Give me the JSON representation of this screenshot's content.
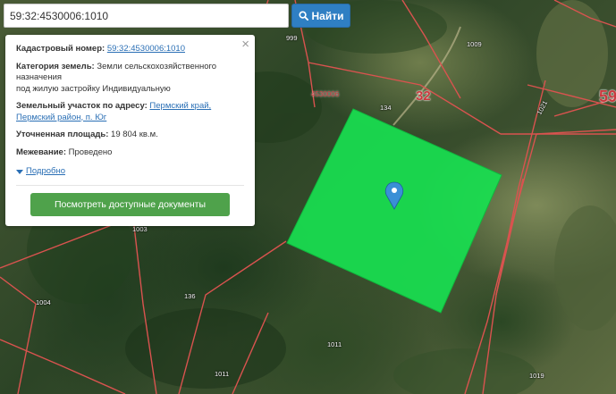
{
  "search": {
    "value": "59:32:4530006:1010",
    "button_label": "Найти",
    "button_icon": "search-icon"
  },
  "popup": {
    "cadastral_label": "Кадастровый номер:",
    "cadastral_value": "59:32:4530006:1010",
    "category_label": "Категория земель:",
    "category_value_1": "Земли сельскохозяйственного",
    "category_value_2": "назначения",
    "category_value_3": "под жилую застройку Индивидуальную",
    "address_label": "Земельный участок по адресу:",
    "address_value_1": "Пермский край,",
    "address_value_2": "Пермский район, п. Юг",
    "area_label": "Уточненная площадь:",
    "area_value": "19 804 кв.м.",
    "survey_label": "Межевание:",
    "survey_value": "Проведено",
    "details_label": "Подробно",
    "docs_button_label": "Посмотреть доступные документы",
    "close_symbol": "×"
  },
  "map": {
    "parcel_color": "#18e050",
    "boundary_color": "#d9534f",
    "marker_color": "#3a8fd6",
    "labels": {
      "l999": "999",
      "l1009": "1009",
      "l1021": "1021",
      "l134": "134",
      "l1003": "1003",
      "l136": "136",
      "l1004": "1004",
      "l1011a": "1011",
      "l1011b": "1011",
      "l1019": "1019",
      "quarter": "4530006",
      "big32": "32",
      "big59": "59"
    }
  }
}
